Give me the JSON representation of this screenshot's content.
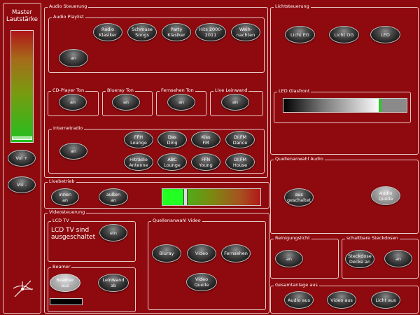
{
  "master": {
    "title": "Master\nLautstärke",
    "vol_plus": "Vol +",
    "vol_minus": "Vol -",
    "level": 0.05
  },
  "audio": {
    "title": "Audio Steuerung",
    "playlist": {
      "title": "Audio Playlist",
      "items": [
        "Radio\nKlasiker",
        "Schmuse\nSongs",
        "Party\nKlasiker",
        "Hits 2000-\n2011",
        "Weih-\nnachten"
      ],
      "on": "an"
    },
    "cd": {
      "title": "CD-Player Ton",
      "on": "an"
    },
    "bluray": {
      "title": "Blueray Ton",
      "on": "an"
    },
    "tv": {
      "title": "Fernsehen Ton",
      "on": "an"
    },
    "screen": {
      "title": "Live Leinwand",
      "on": "an"
    },
    "radio": {
      "title": "Internetradio",
      "on": "an",
      "stations": [
        "FFH\nLounge",
        "Das\nDing",
        "Kiss\nFM",
        "DI.FM\nDance",
        "Hitradio\nAntenne",
        "ABC\nLounge",
        "FFN\nYoung",
        "DI.FM\nHouse"
      ]
    }
  },
  "live": {
    "title": "Livebetrieb",
    "inside": "innen\nan",
    "outside": "außen\nan",
    "level": 0.2
  },
  "light": {
    "title": "Lichtsteuerung",
    "buttons": [
      "Licht EG",
      "Licht OG",
      "LED"
    ]
  },
  "led": {
    "title": "LED Glasfront",
    "level": 0.69
  },
  "source_audio": {
    "title": "Quellenanwahl Audio",
    "off": "aus\ngeschaltet",
    "source": "Audio\nQuelle"
  },
  "video": {
    "title": "Videosteuerung",
    "lcd": {
      "title": "LCD TV",
      "status": "LCD TV sind\nausgeschaltet",
      "on": "ein"
    },
    "beamer": {
      "title": "Beamer",
      "off": "Beamer\naus",
      "screen": "Leinwand\nab"
    },
    "source": {
      "title": "Quellenanwahl Video",
      "items": [
        "Bluray",
        "Video",
        "Fernsehen",
        "Video\nQuelle"
      ]
    }
  },
  "cleaning": {
    "title": "Reinigungslicht",
    "on": "an"
  },
  "sockets": {
    "title": "schaltbare Steckdosen",
    "ceiling": "Steckdose\nDecke an",
    "on": "an"
  },
  "system": {
    "title": "Gesamtanlage aus",
    "buttons": [
      "Audio aus",
      "Video aus",
      "Licht aus"
    ]
  }
}
